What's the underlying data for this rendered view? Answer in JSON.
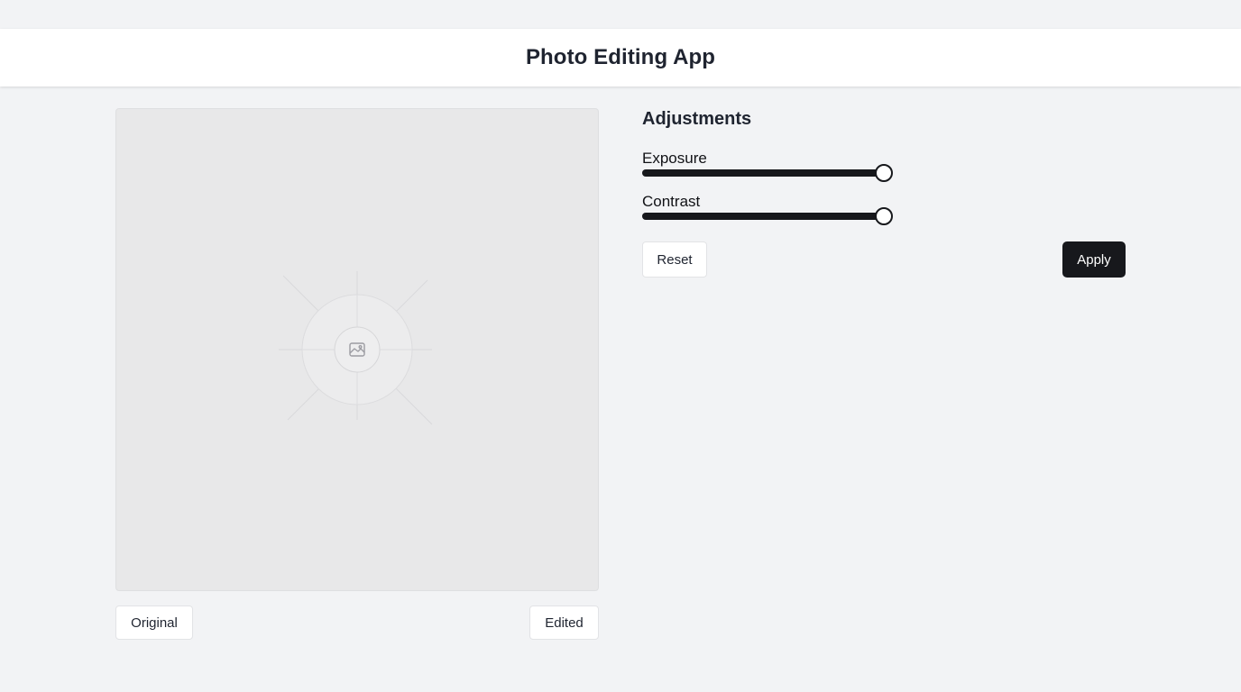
{
  "header": {
    "title": "Photo Editing App"
  },
  "preview": {
    "icon": "image-placeholder-icon"
  },
  "view_toggle": {
    "original_label": "Original",
    "edited_label": "Edited"
  },
  "adjustments": {
    "title": "Adjustments",
    "sliders": [
      {
        "label": "Exposure",
        "fraction": 1.0
      },
      {
        "label": "Contrast",
        "fraction": 1.0
      }
    ],
    "reset_label": "Reset",
    "apply_label": "Apply"
  },
  "colors": {
    "background": "#f2f3f5",
    "accent": "#17181c",
    "surface": "#ffffff"
  }
}
